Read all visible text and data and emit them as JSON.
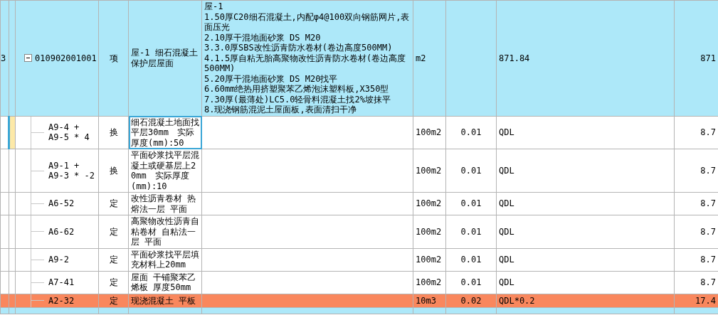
{
  "bill": {
    "row_number": "3",
    "code": "010902001001",
    "expanded": true,
    "type": "项",
    "name": "屋-1 细石混凝土保护层屋面",
    "features": [
      "屋-1",
      "1.50厚C20细石混凝土,内配φ4@100双向钢筋网片,表面压光",
      "2.10厚干混地面砂浆 DS M20",
      "3.3.0厚SBS改性沥青防水卷材(卷边高度500MM)",
      "4.1.5厚自粘无胎高聚物改性沥青防水卷材(卷边高度500MM)",
      "5.20厚干混地面砂浆 DS M20找平",
      "6.60mm绝热用挤塑聚苯乙烯泡沫塑料板,X350型",
      "7.30厚(最薄处)LC5.0轻骨料混凝土找2%坡抹平",
      "8.现浇钢筋混泥土屋面板,表面清扫干净"
    ],
    "unit": "m2",
    "quantity_expr": "871.84",
    "quantity": "871"
  },
  "items": [
    {
      "code": "A9-4 + A9-5 * 4",
      "type": "换",
      "name": "细石混凝土地面找平层30mm　实际厚度(mm):50",
      "unit": "100m2",
      "coefficient": "0.01",
      "quantity_expr": "QDL",
      "quantity": "8.7",
      "selected": true,
      "highlighted": false
    },
    {
      "code": "A9-1 + A9-3 * -2",
      "type": "换",
      "name": "平面砂浆找平层混凝土或硬基层上20mm　实际厚度(mm):10",
      "unit": "100m2",
      "coefficient": "0.01",
      "quantity_expr": "QDL",
      "quantity": "8.7",
      "selected": false,
      "highlighted": false
    },
    {
      "code": "A6-52",
      "type": "定",
      "name": "改性沥青卷材 热熔法一层 平面",
      "unit": "100m2",
      "coefficient": "0.01",
      "quantity_expr": "QDL",
      "quantity": "8.7",
      "selected": false,
      "highlighted": false
    },
    {
      "code": "A6-62",
      "type": "定",
      "name": "高聚物改性沥青自粘卷材 自粘法一层 平面",
      "unit": "100m2",
      "coefficient": "0.01",
      "quantity_expr": "QDL",
      "quantity": "8.7",
      "selected": false,
      "highlighted": false
    },
    {
      "code": "A9-2",
      "type": "定",
      "name": "平面砂浆找平层填充材料上20mm",
      "unit": "100m2",
      "coefficient": "0.01",
      "quantity_expr": "QDL",
      "quantity": "8.7",
      "selected": false,
      "highlighted": false
    },
    {
      "code": "A7-41",
      "type": "定",
      "name": "屋面 干铺聚苯乙烯板 厚度50mm",
      "unit": "100m2",
      "coefficient": "0.01",
      "quantity_expr": "QDL",
      "quantity": "8.7",
      "selected": false,
      "highlighted": false
    },
    {
      "code": "A2-32",
      "type": "定",
      "name": "现浇混凝土 平板",
      "unit": "10m3",
      "coefficient": "0.02",
      "quantity_expr": "QDL*0.2",
      "quantity": "17.4",
      "selected": false,
      "highlighted": true
    }
  ]
}
